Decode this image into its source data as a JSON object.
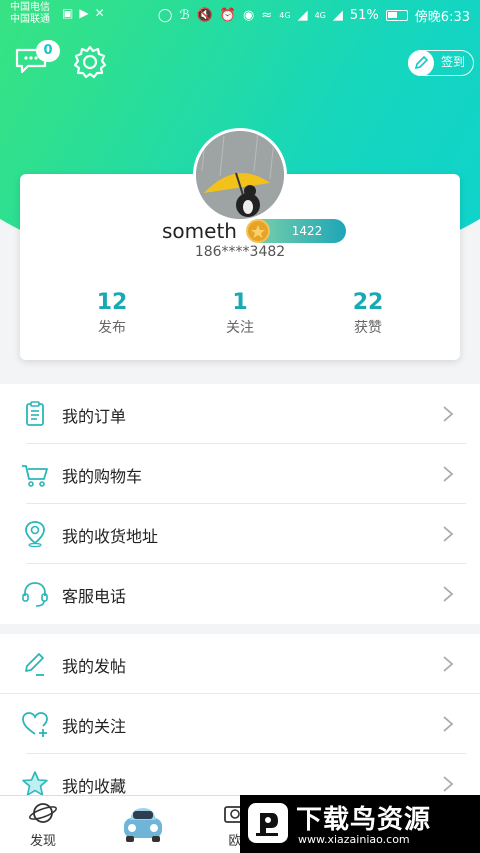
{
  "status_bar": {
    "carrier1": "中国电信",
    "carrier2": "中国联通",
    "battery": "51%",
    "time": "傍晚6:33",
    "net1": "4G",
    "net2": "4G"
  },
  "header": {
    "message_badge": "0",
    "sign_in_label": "签到"
  },
  "profile": {
    "username": "someth",
    "level_points": "1422",
    "phone": "186****3482"
  },
  "stats": [
    {
      "value": "12",
      "label": "发布"
    },
    {
      "value": "1",
      "label": "关注"
    },
    {
      "value": "22",
      "label": "获赞"
    }
  ],
  "menu_group1": [
    {
      "label": "我的订单",
      "icon": "order-icon"
    },
    {
      "label": "我的购物车",
      "icon": "cart-icon"
    },
    {
      "label": "我的收货地址",
      "icon": "location-icon"
    },
    {
      "label": "客服电话",
      "icon": "headset-icon"
    }
  ],
  "menu_group2": [
    {
      "label": "我的发帖",
      "icon": "edit-icon"
    },
    {
      "label": "我的关注",
      "icon": "heart-plus-icon"
    },
    {
      "label": "我的收藏",
      "icon": "star-icon"
    }
  ],
  "tabbar": {
    "tabs": [
      {
        "label": "发现",
        "icon": "planet-icon"
      },
      {
        "label": "",
        "icon": "car-icon"
      },
      {
        "label": "欧",
        "icon": "camera-icon"
      }
    ]
  },
  "watermark": {
    "title": "下载鸟资源",
    "url": "www.xiazainiao.com"
  },
  "colors": {
    "accent": "#18a9b5",
    "gradient_start": "#48e86a",
    "gradient_end": "#0bd1d6"
  }
}
